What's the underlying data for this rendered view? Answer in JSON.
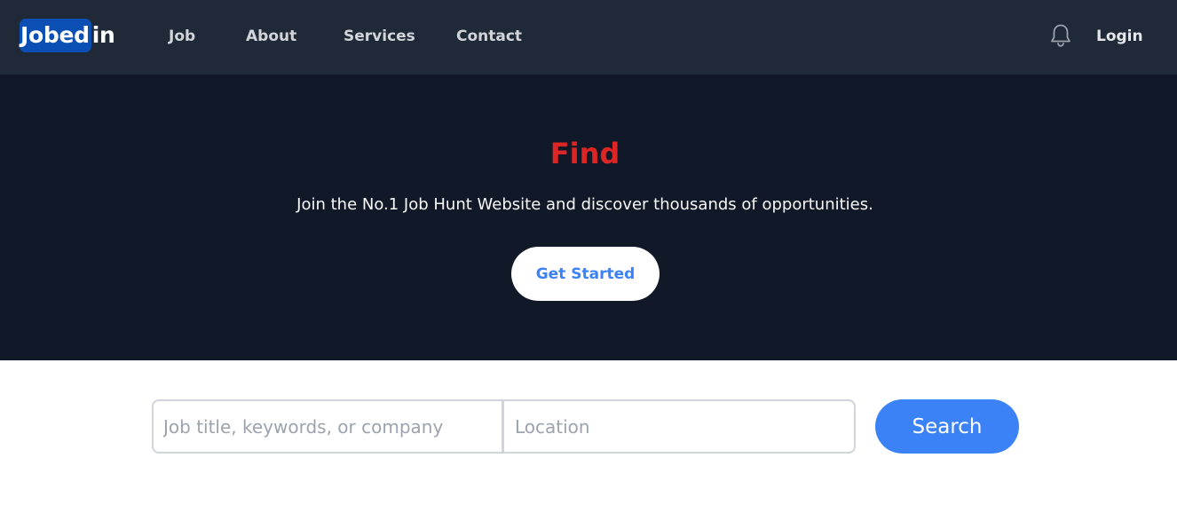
{
  "brand": {
    "logo_highlight": "Jobed",
    "logo_rest": "in",
    "logo_bg_color": "#0b4fb4"
  },
  "nav": {
    "items": [
      {
        "label": "Job"
      },
      {
        "label": "About"
      },
      {
        "label": "Services"
      },
      {
        "label": "Contact"
      }
    ],
    "notification_icon": "bell-icon",
    "login_label": "Login",
    "bg_color": "#1f2937"
  },
  "hero": {
    "title": "Find",
    "subtitle": "Join the No.1 Job Hunt Website and discover thousands of opportunities.",
    "cta_label": "Get Started",
    "title_color": "#dc2626",
    "bg_color": "#111827"
  },
  "search": {
    "keywords_placeholder": "Job title, keywords, or company",
    "keywords_value": "",
    "location_placeholder": "Location",
    "location_value": "",
    "button_label": "Search",
    "accent_color": "#3b82f6"
  }
}
